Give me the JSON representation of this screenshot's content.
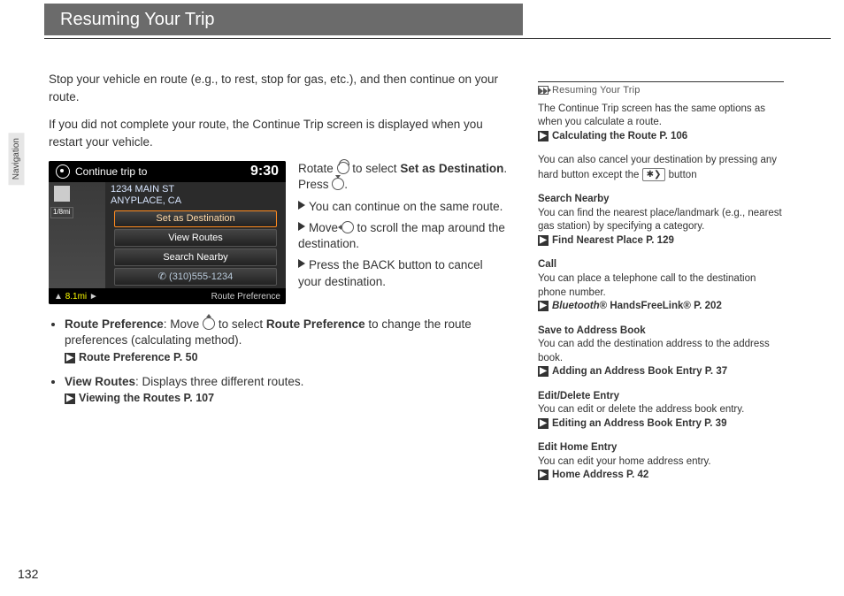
{
  "page_number": "132",
  "tab_label": "Navigation",
  "header": {
    "title": "Resuming Your Trip"
  },
  "main": {
    "intro1": "Stop your vehicle en route (e.g., to rest, stop for gas, etc.), and then continue on your route.",
    "intro2": "If you did not complete your route, the Continue Trip screen is displayed when you restart your vehicle."
  },
  "screenshot": {
    "top_label": "Continue trip to",
    "clock": "9:30",
    "scale": "1/8mi",
    "addr_line1": "1234 MAIN ST",
    "addr_line2": "ANYPLACE, CA",
    "btn1": "Set as Destination",
    "btn2": "View Routes",
    "btn3": "Search Nearby",
    "phone": "(310)555-1234",
    "bottom_left": "8.1mi",
    "bottom_right": "Route Preference"
  },
  "instr": {
    "rotate_a": "Rotate ",
    "rotate_b": " to select ",
    "rotate_target": "Set as Destination",
    "rotate_c": ". Press ",
    "rotate_d": ".",
    "b1": "You can continue on the same route.",
    "b2a": "Move ",
    "b2b": " to scroll the map around the destination.",
    "b3": "Press the BACK button to cancel your destination."
  },
  "bullets": {
    "rp_label": "Route Preference",
    "rp_a": ": Move ",
    "rp_b": " to select ",
    "rp_target": "Route Preference",
    "rp_c": " to change the route preferences (calculating method).",
    "rp_xref": "Route Preference",
    "rp_page": " P. 50",
    "vr_label": "View Routes",
    "vr_text": ": Displays three different routes.",
    "vr_xref": "Viewing the Routes",
    "vr_page": " P. 107"
  },
  "side": {
    "hdr": "Resuming Your Trip",
    "s1_text": "The Continue Trip screen has the same options as when you calculate a route.",
    "s1_xref": "Calculating the Route",
    "s1_page": " P. 106",
    "s2_a": "You can also cancel your destination by pressing any hard button except the ",
    "s2_key": "✱",
    "s2_b": " button",
    "sn_t": "Search Nearby",
    "sn_text": "You can find the nearest place/landmark (e.g., nearest gas station) by specifying a category.",
    "sn_xref": "Find Nearest Place",
    "sn_page": " P. 129",
    "call_t": "Call",
    "call_text": "You can place a telephone call to the destination phone number.",
    "call_xref_i": "Bluetooth",
    "call_xref_r": "® HandsFreeLink®",
    "call_page": " P. 202",
    "sab_t": "Save to Address Book",
    "sab_text": "You can add the destination address to the address book.",
    "sab_xref": "Adding an Address Book Entry",
    "sab_page": " P. 37",
    "ede_t": "Edit/Delete Entry",
    "ede_text": "You can edit or delete the address book entry.",
    "ede_xref": "Editing an Address Book Entry",
    "ede_page": " P. 39",
    "ehe_t": "Edit Home Entry",
    "ehe_text": "You can edit your home address entry.",
    "ehe_xref": "Home Address",
    "ehe_page": " P. 42"
  }
}
